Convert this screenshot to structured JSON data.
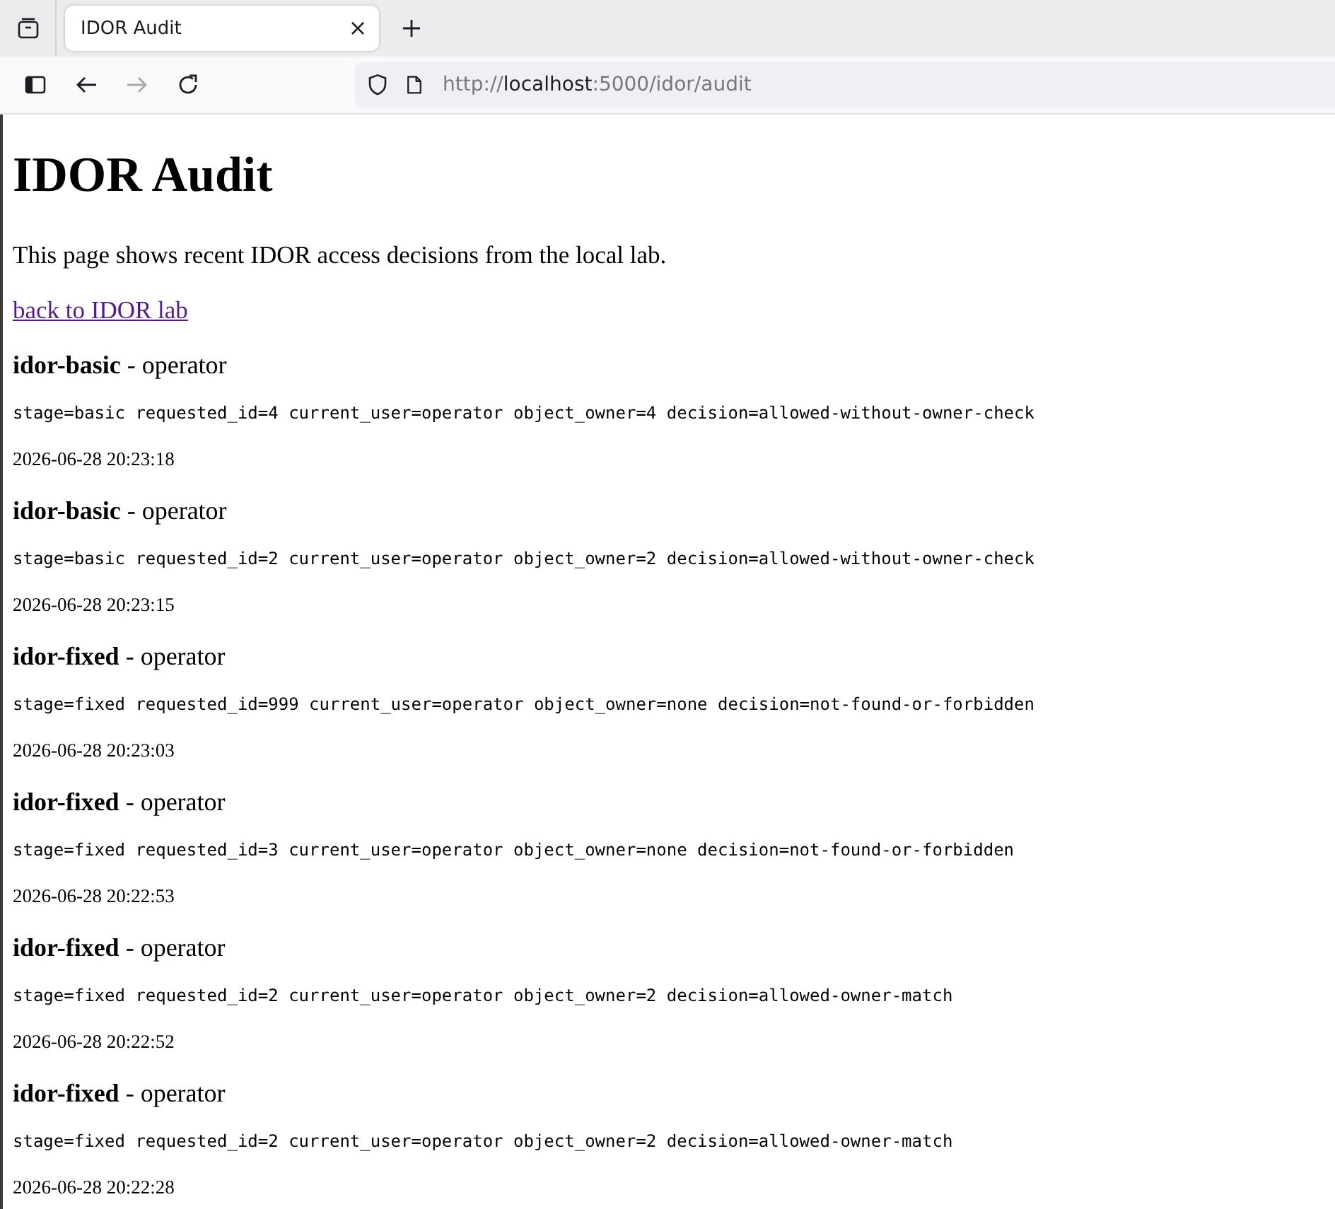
{
  "browser": {
    "tab": {
      "title": "IDOR Audit",
      "selected": true
    },
    "navigation": {
      "back": {
        "disabled": false
      },
      "forward": {
        "disabled": true
      }
    },
    "url": {
      "scheme": "http://",
      "host": "localhost",
      "path": ":5000/idor/audit"
    }
  },
  "page": {
    "title": "IDOR Audit",
    "intro": "This page shows recent IDOR access decisions from the local lab.",
    "back_link": "back to IDOR lab",
    "entries": [
      {
        "heading": "**idor-basic** - operator",
        "details": "stage=basic requested_id=4 current_user=operator object_owner=4 decision=allowed-without-owner-check",
        "time": "2026-06-28 20:23:18"
      },
      {
        "heading": "**idor-basic** - operator",
        "details": "stage=basic requested_id=2 current_user=operator object_owner=2 decision=allowed-without-owner-check",
        "time": "2026-06-28 20:23:15"
      },
      {
        "heading": "**idor-fixed** - operator",
        "details": "stage=fixed requested_id=999 current_user=operator object_owner=none decision=not-found-or-forbidden",
        "time": "2026-06-28 20:23:03"
      },
      {
        "heading": "**idor-fixed** - operator",
        "details": "stage=fixed requested_id=3 current_user=operator object_owner=none decision=not-found-or-forbidden",
        "time": "2026-06-28 20:22:53"
      },
      {
        "heading": "**idor-fixed** - operator",
        "details": "stage=fixed requested_id=2 current_user=operator object_owner=2 decision=allowed-owner-match",
        "time": "2026-06-28 20:22:52"
      },
      {
        "heading": "**idor-fixed** - operator",
        "details": "stage=fixed requested_id=2 current_user=operator object_owner=2 decision=allowed-owner-match",
        "time": "2026-06-28 20:22:28"
      }
    ]
  }
}
